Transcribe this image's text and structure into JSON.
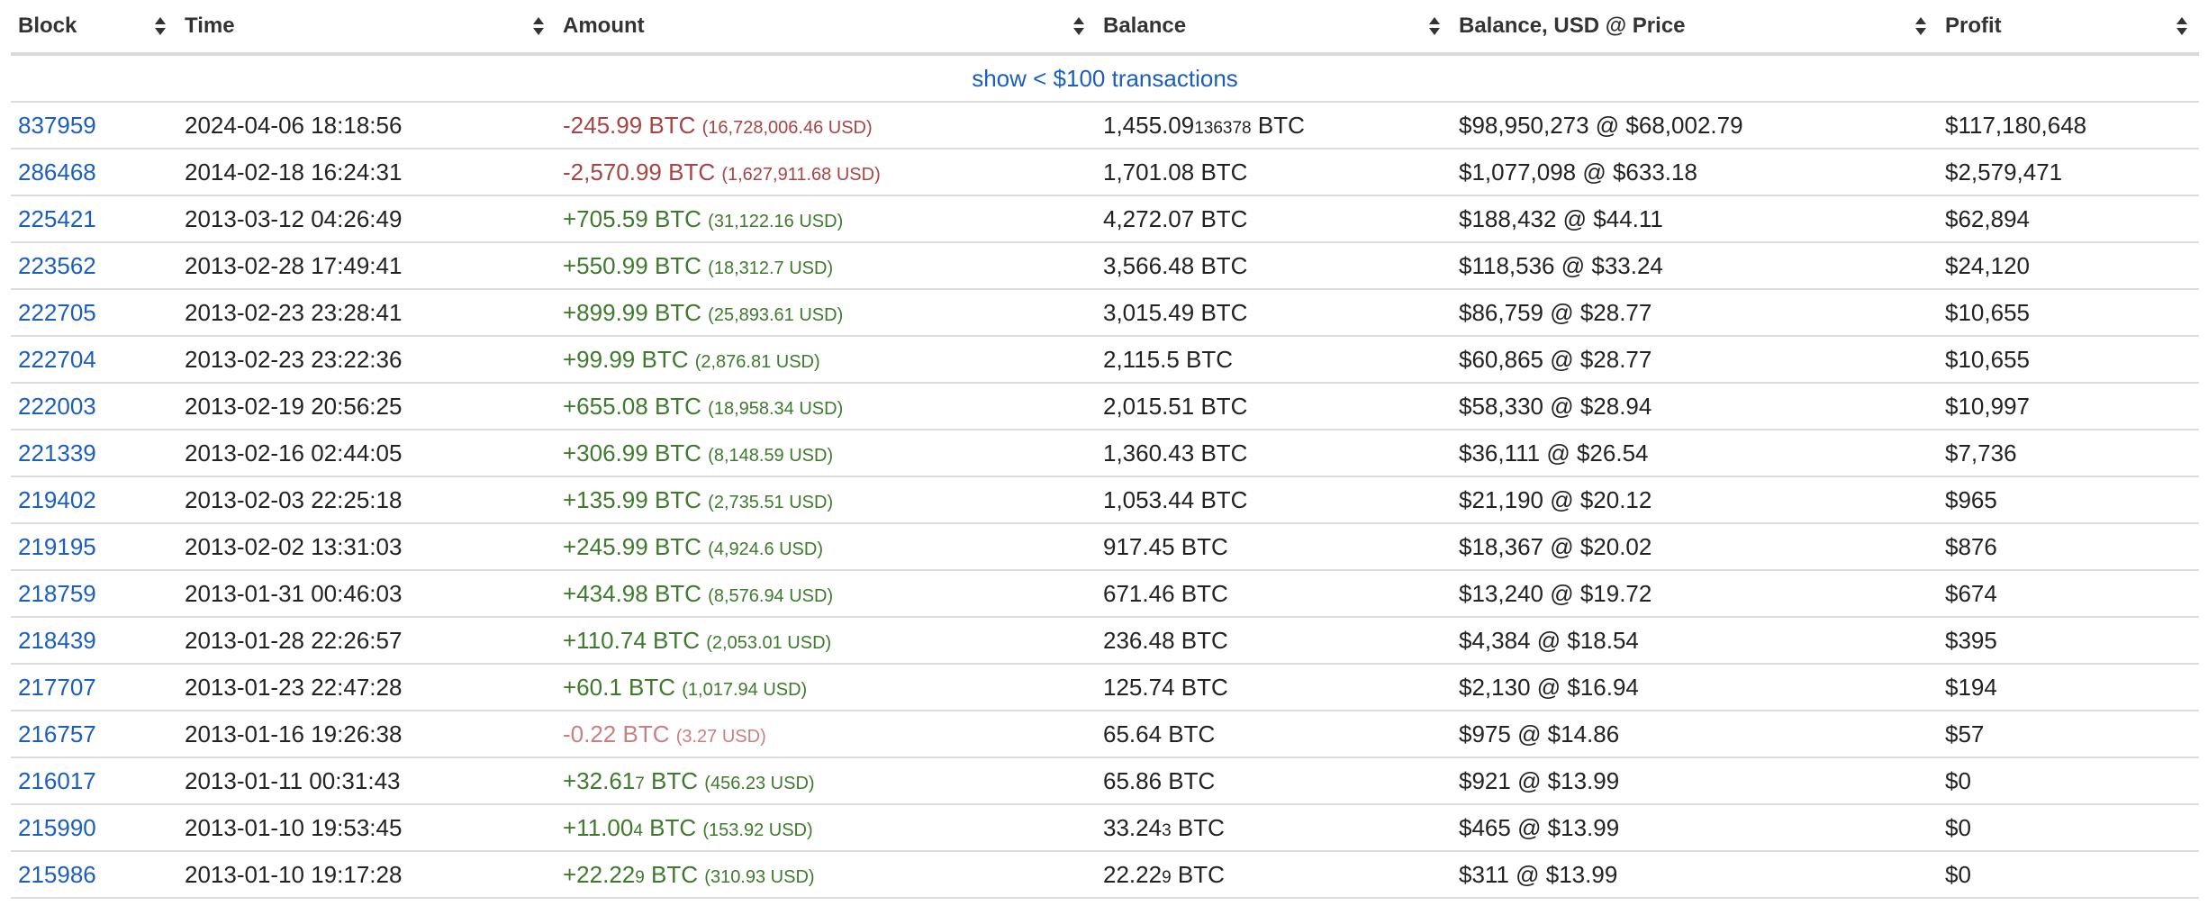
{
  "headers": {
    "block": "Block",
    "time": "Time",
    "amount": "Amount",
    "balance": "Balance",
    "balance_usd": "Balance, USD @ Price",
    "profit": "Profit"
  },
  "show_small": "show < $100 transactions",
  "colors": {
    "link": "#1a5ec0",
    "negative": "#a94442",
    "positive": "#3d7a2c",
    "row_border": "#dddddd"
  },
  "rows": [
    {
      "block": "837959",
      "time": "2024-04-06 18:18:56",
      "amount_main": "-245.99",
      "amount_tail": "",
      "amount_unit": " BTC ",
      "amount_usd": "(16,728,006.46 USD)",
      "sign": "neg",
      "balance_main": "1,455.09",
      "balance_tail": "136378",
      "balance_unit": " BTC",
      "balance_usd": "$98,950,273 @ $68,002.79",
      "profit": "$117,180,648"
    },
    {
      "block": "286468",
      "time": "2014-02-18 16:24:31",
      "amount_main": "-2,570.99",
      "amount_tail": "",
      "amount_unit": " BTC ",
      "amount_usd": "(1,627,911.68 USD)",
      "sign": "neg",
      "balance_main": "1,701.08",
      "balance_tail": "",
      "balance_unit": " BTC",
      "balance_usd": "$1,077,098 @ $633.18",
      "profit": "$2,579,471"
    },
    {
      "block": "225421",
      "time": "2013-03-12 04:26:49",
      "amount_main": "+705.59",
      "amount_tail": "",
      "amount_unit": " BTC ",
      "amount_usd": "(31,122.16 USD)",
      "sign": "pos",
      "balance_main": "4,272.07",
      "balance_tail": "",
      "balance_unit": " BTC",
      "balance_usd": "$188,432 @ $44.11",
      "profit": "$62,894"
    },
    {
      "block": "223562",
      "time": "2013-02-28 17:49:41",
      "amount_main": "+550.99",
      "amount_tail": "",
      "amount_unit": " BTC ",
      "amount_usd": "(18,312.7 USD)",
      "sign": "pos",
      "balance_main": "3,566.48",
      "balance_tail": "",
      "balance_unit": " BTC",
      "balance_usd": "$118,536 @ $33.24",
      "profit": "$24,120"
    },
    {
      "block": "222705",
      "time": "2013-02-23 23:28:41",
      "amount_main": "+899.99",
      "amount_tail": "",
      "amount_unit": " BTC ",
      "amount_usd": "(25,893.61 USD)",
      "sign": "pos",
      "balance_main": "3,015.49",
      "balance_tail": "",
      "balance_unit": " BTC",
      "balance_usd": "$86,759 @ $28.77",
      "profit": "$10,655"
    },
    {
      "block": "222704",
      "time": "2013-02-23 23:22:36",
      "amount_main": "+99.99",
      "amount_tail": "",
      "amount_unit": " BTC ",
      "amount_usd": "(2,876.81 USD)",
      "sign": "pos",
      "balance_main": "2,115.5",
      "balance_tail": "",
      "balance_unit": " BTC",
      "balance_usd": "$60,865 @ $28.77",
      "profit": "$10,655"
    },
    {
      "block": "222003",
      "time": "2013-02-19 20:56:25",
      "amount_main": "+655.08",
      "amount_tail": "",
      "amount_unit": " BTC ",
      "amount_usd": "(18,958.34 USD)",
      "sign": "pos",
      "balance_main": "2,015.51",
      "balance_tail": "",
      "balance_unit": " BTC",
      "balance_usd": "$58,330 @ $28.94",
      "profit": "$10,997"
    },
    {
      "block": "221339",
      "time": "2013-02-16 02:44:05",
      "amount_main": "+306.99",
      "amount_tail": "",
      "amount_unit": " BTC ",
      "amount_usd": "(8,148.59 USD)",
      "sign": "pos",
      "balance_main": "1,360.43",
      "balance_tail": "",
      "balance_unit": " BTC",
      "balance_usd": "$36,111 @ $26.54",
      "profit": "$7,736"
    },
    {
      "block": "219402",
      "time": "2013-02-03 22:25:18",
      "amount_main": "+135.99",
      "amount_tail": "",
      "amount_unit": " BTC ",
      "amount_usd": "(2,735.51 USD)",
      "sign": "pos",
      "balance_main": "1,053.44",
      "balance_tail": "",
      "balance_unit": " BTC",
      "balance_usd": "$21,190 @ $20.12",
      "profit": "$965"
    },
    {
      "block": "219195",
      "time": "2013-02-02 13:31:03",
      "amount_main": "+245.99",
      "amount_tail": "",
      "amount_unit": " BTC ",
      "amount_usd": "(4,924.6 USD)",
      "sign": "pos",
      "balance_main": "917.45",
      "balance_tail": "",
      "balance_unit": " BTC",
      "balance_usd": "$18,367 @ $20.02",
      "profit": "$876"
    },
    {
      "block": "218759",
      "time": "2013-01-31 00:46:03",
      "amount_main": "+434.98",
      "amount_tail": "",
      "amount_unit": " BTC ",
      "amount_usd": "(8,576.94 USD)",
      "sign": "pos",
      "balance_main": "671.46",
      "balance_tail": "",
      "balance_unit": " BTC",
      "balance_usd": "$13,240 @ $19.72",
      "profit": "$674"
    },
    {
      "block": "218439",
      "time": "2013-01-28 22:26:57",
      "amount_main": "+110.74",
      "amount_tail": "",
      "amount_unit": " BTC ",
      "amount_usd": "(2,053.01 USD)",
      "sign": "pos",
      "balance_main": "236.48",
      "balance_tail": "",
      "balance_unit": " BTC",
      "balance_usd": "$4,384 @ $18.54",
      "profit": "$395"
    },
    {
      "block": "217707",
      "time": "2013-01-23 22:47:28",
      "amount_main": "+60.1",
      "amount_tail": "",
      "amount_unit": " BTC ",
      "amount_usd": "(1,017.94 USD)",
      "sign": "pos",
      "balance_main": "125.74",
      "balance_tail": "",
      "balance_unit": " BTC",
      "balance_usd": "$2,130 @ $16.94",
      "profit": "$194"
    },
    {
      "block": "216757",
      "time": "2013-01-16 19:26:38",
      "amount_main": "-0.22",
      "amount_tail": "",
      "amount_unit": " BTC ",
      "amount_usd": "(3.27 USD)",
      "sign": "neg-light",
      "balance_main": "65.64",
      "balance_tail": "",
      "balance_unit": " BTC",
      "balance_usd": "$975 @ $14.86",
      "profit": "$57"
    },
    {
      "block": "216017",
      "time": "2013-01-11 00:31:43",
      "amount_main": "+32.61",
      "amount_tail": "7",
      "amount_unit": " BTC ",
      "amount_usd": "(456.23 USD)",
      "sign": "pos",
      "balance_main": "65.86",
      "balance_tail": "",
      "balance_unit": " BTC",
      "balance_usd": "$921 @ $13.99",
      "profit": "$0"
    },
    {
      "block": "215990",
      "time": "2013-01-10 19:53:45",
      "amount_main": "+11.00",
      "amount_tail": "4",
      "amount_unit": " BTC ",
      "amount_usd": "(153.92 USD)",
      "sign": "pos",
      "balance_main": "33.24",
      "balance_tail": "3",
      "balance_unit": " BTC",
      "balance_usd": "$465 @ $13.99",
      "profit": "$0"
    },
    {
      "block": "215986",
      "time": "2013-01-10 19:17:28",
      "amount_main": "+22.22",
      "amount_tail": "9",
      "amount_unit": " BTC ",
      "amount_usd": "(310.93 USD)",
      "sign": "pos",
      "balance_main": "22.22",
      "balance_tail": "9",
      "balance_unit": " BTC",
      "balance_usd": "$311 @ $13.99",
      "profit": "$0"
    }
  ]
}
